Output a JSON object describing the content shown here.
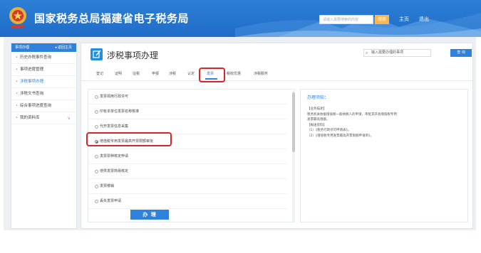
{
  "header": {
    "title": "国家税务总局福建省电子税务局",
    "search_placeholder": "请输入需要搜索的内容",
    "search_button": "搜索",
    "links": [
      "主页",
      "退出"
    ],
    "bg_color": "#1f6cc8"
  },
  "sidebar": {
    "title": "事项办理",
    "back_label": "◂ 返回主页",
    "items": [
      {
        "label": "历史办税事件查询"
      },
      {
        "label": "事项进度管理"
      },
      {
        "label": "涉税事项办理",
        "active": true
      },
      {
        "label": "涉税文书查询"
      },
      {
        "label": "综合事项进度查询"
      },
      {
        "label": "我的资料库",
        "has_chevron": true
      }
    ]
  },
  "main": {
    "title": "涉税事项办理",
    "search_text": "输入需要办理的事项",
    "search_button": "查 询",
    "tabs": [
      "登记",
      "证明",
      "征税",
      "申报",
      "涉税",
      "认定",
      "发票",
      "税收优惠",
      "涉税服务"
    ],
    "active_tab": "发票",
    "list": [
      {
        "label": "发票领用行政许可"
      },
      {
        "label": "印有本单位发票名称核准"
      },
      {
        "label": "代开发票信息采集"
      },
      {
        "label": "增值税专用发票最高开票限额审批",
        "selected": true
      },
      {
        "label": "发票票种核定申请"
      },
      {
        "label": "增供发票简易核定"
      },
      {
        "label": "发票缴销"
      },
      {
        "label": "丢失发票申请"
      }
    ],
    "submit_button": "办 理",
    "notes": {
      "title": "办理须知：",
      "lines": [
        "【业务描述】",
        "税务机关依据增值税一般纳税人的申请，审批其开具增值税专用",
        "发票最高限额。",
        "【报送资料】",
        "（1）《税务行政许可申请表》。",
        "（2）《增值税专用发票最高开票限额申请单》。"
      ]
    }
  },
  "colors": {
    "accent": "#2e82d9",
    "highlight": "#d9252a"
  }
}
